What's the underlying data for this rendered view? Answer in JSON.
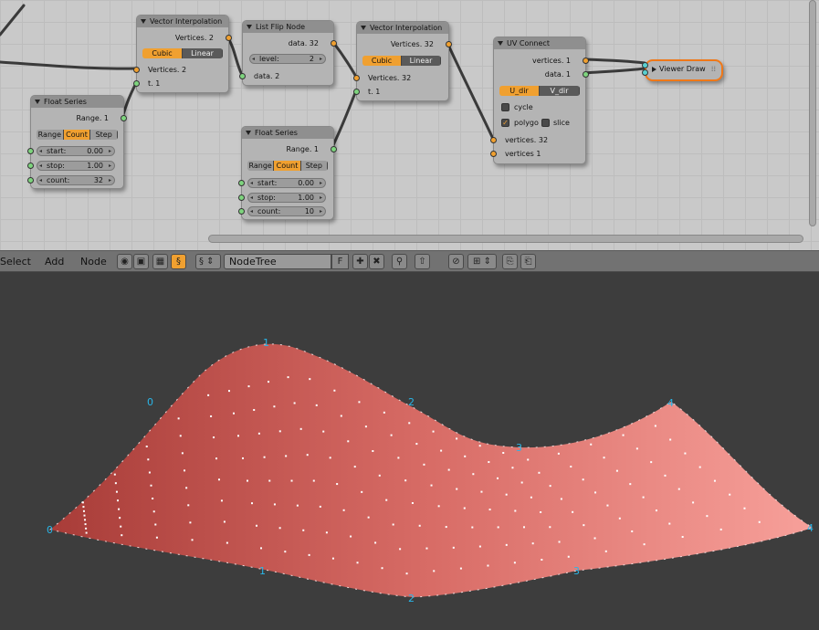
{
  "nodes": {
    "vec_interp_1": {
      "title": "Vector Interpolation",
      "out_vertices": "Vertices. 2",
      "mode_cubic": "Cubic",
      "mode_linear": "Linear",
      "in_vertices": "Vertices. 2",
      "in_t": "t. 1"
    },
    "float_series_1": {
      "title": "Float Series",
      "out_range": "Range. 1",
      "tab_range": "Range",
      "tab_count": "Count",
      "tab_step": "Step",
      "start_label": "start:",
      "start_value": "0.00",
      "stop_label": "stop:",
      "stop_value": "1.00",
      "count_label": "count:",
      "count_value": "32"
    },
    "list_flip": {
      "title": "List Flip Node",
      "out_data": "data. 32",
      "level_label": "level:",
      "level_value": "2",
      "in_data": "data. 2"
    },
    "float_series_2": {
      "title": "Float Series",
      "out_range": "Range. 1",
      "tab_range": "Range",
      "tab_count": "Count",
      "tab_step": "Step",
      "start_label": "start:",
      "start_value": "0.00",
      "stop_label": "stop:",
      "stop_value": "1.00",
      "count_label": "count:",
      "count_value": "10"
    },
    "vec_interp_2": {
      "title": "Vector Interpolation",
      "out_vertices": "Vertices. 32",
      "mode_cubic": "Cubic",
      "mode_linear": "Linear",
      "in_vertices": "Vertices. 32",
      "in_t": "t. 1"
    },
    "uv_connect": {
      "title": "UV Connect",
      "out_vertices": "vertices. 1",
      "out_data": "data. 1",
      "tab_u": "U_dir",
      "tab_v": "V_dir",
      "cycle_label": "cycle",
      "polygo_label": "polygo",
      "slice_label": "slice",
      "in_vertices32": "vertices. 32",
      "in_vertices1": "vertices 1"
    },
    "viewer_draw": {
      "title": "Viewer Draw"
    }
  },
  "header": {
    "menu_select": "Select",
    "menu_add": "Add",
    "menu_node": "Node",
    "tree_name": "NodeTree",
    "fake_user": "F"
  },
  "viewport": {
    "surface_color_dark": "#a83c38",
    "surface_color_light": "#f7a09a",
    "vertex_label_color": "#29b6e8",
    "labels": [
      "1",
      "0",
      "2",
      "3",
      "4",
      "0",
      "1",
      "2",
      "3",
      "4"
    ]
  },
  "colors": {
    "accent": "#f0a030",
    "socket_green": "#7ed47e"
  }
}
